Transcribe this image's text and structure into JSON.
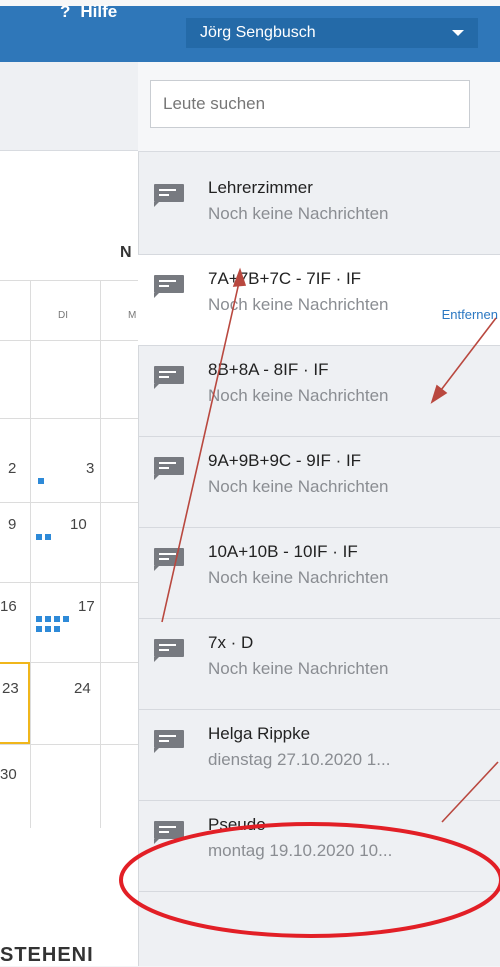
{
  "topbar": {
    "help_label": "Hilfe",
    "user_name": "Jörg Sengbusch"
  },
  "calendar": {
    "month_letter": "N",
    "day_labels": [
      "DI",
      "M"
    ],
    "numbers": [
      "2",
      "3",
      "9",
      "10",
      "16",
      "17",
      "23",
      "24",
      "30"
    ],
    "bottom_heading": "STEHENI"
  },
  "chat": {
    "search_placeholder": "Leute suchen",
    "remove_label": "Entfernen",
    "items": [
      {
        "title": "Lehrerzimmer",
        "subtitle": "Noch keine Nachrichten"
      },
      {
        "title": "7A+7B+7C - 7IF · IF",
        "subtitle": "Noch keine Nachrichten"
      },
      {
        "title": "8B+8A - 8IF · IF",
        "subtitle": "Noch keine Nachrichten"
      },
      {
        "title": "9A+9B+9C - 9IF · IF",
        "subtitle": "Noch keine Nachrichten"
      },
      {
        "title": "10A+10B - 10IF · IF",
        "subtitle": "Noch keine Nachrichten"
      },
      {
        "title": "7x · D",
        "subtitle": "Noch keine Nachrichten"
      },
      {
        "title": "Helga Rippke",
        "subtitle": "dienstag 27.10.2020 1..."
      },
      {
        "title": "Pseudo",
        "subtitle": "montag 19.10.2020 10..."
      }
    ]
  },
  "colors": {
    "topbar": "#2f77b9",
    "annotation_red": "#e21f26",
    "arrow_brown": "#b9483f",
    "link_blue": "#2b78c2",
    "today_border": "#f0b61b"
  }
}
